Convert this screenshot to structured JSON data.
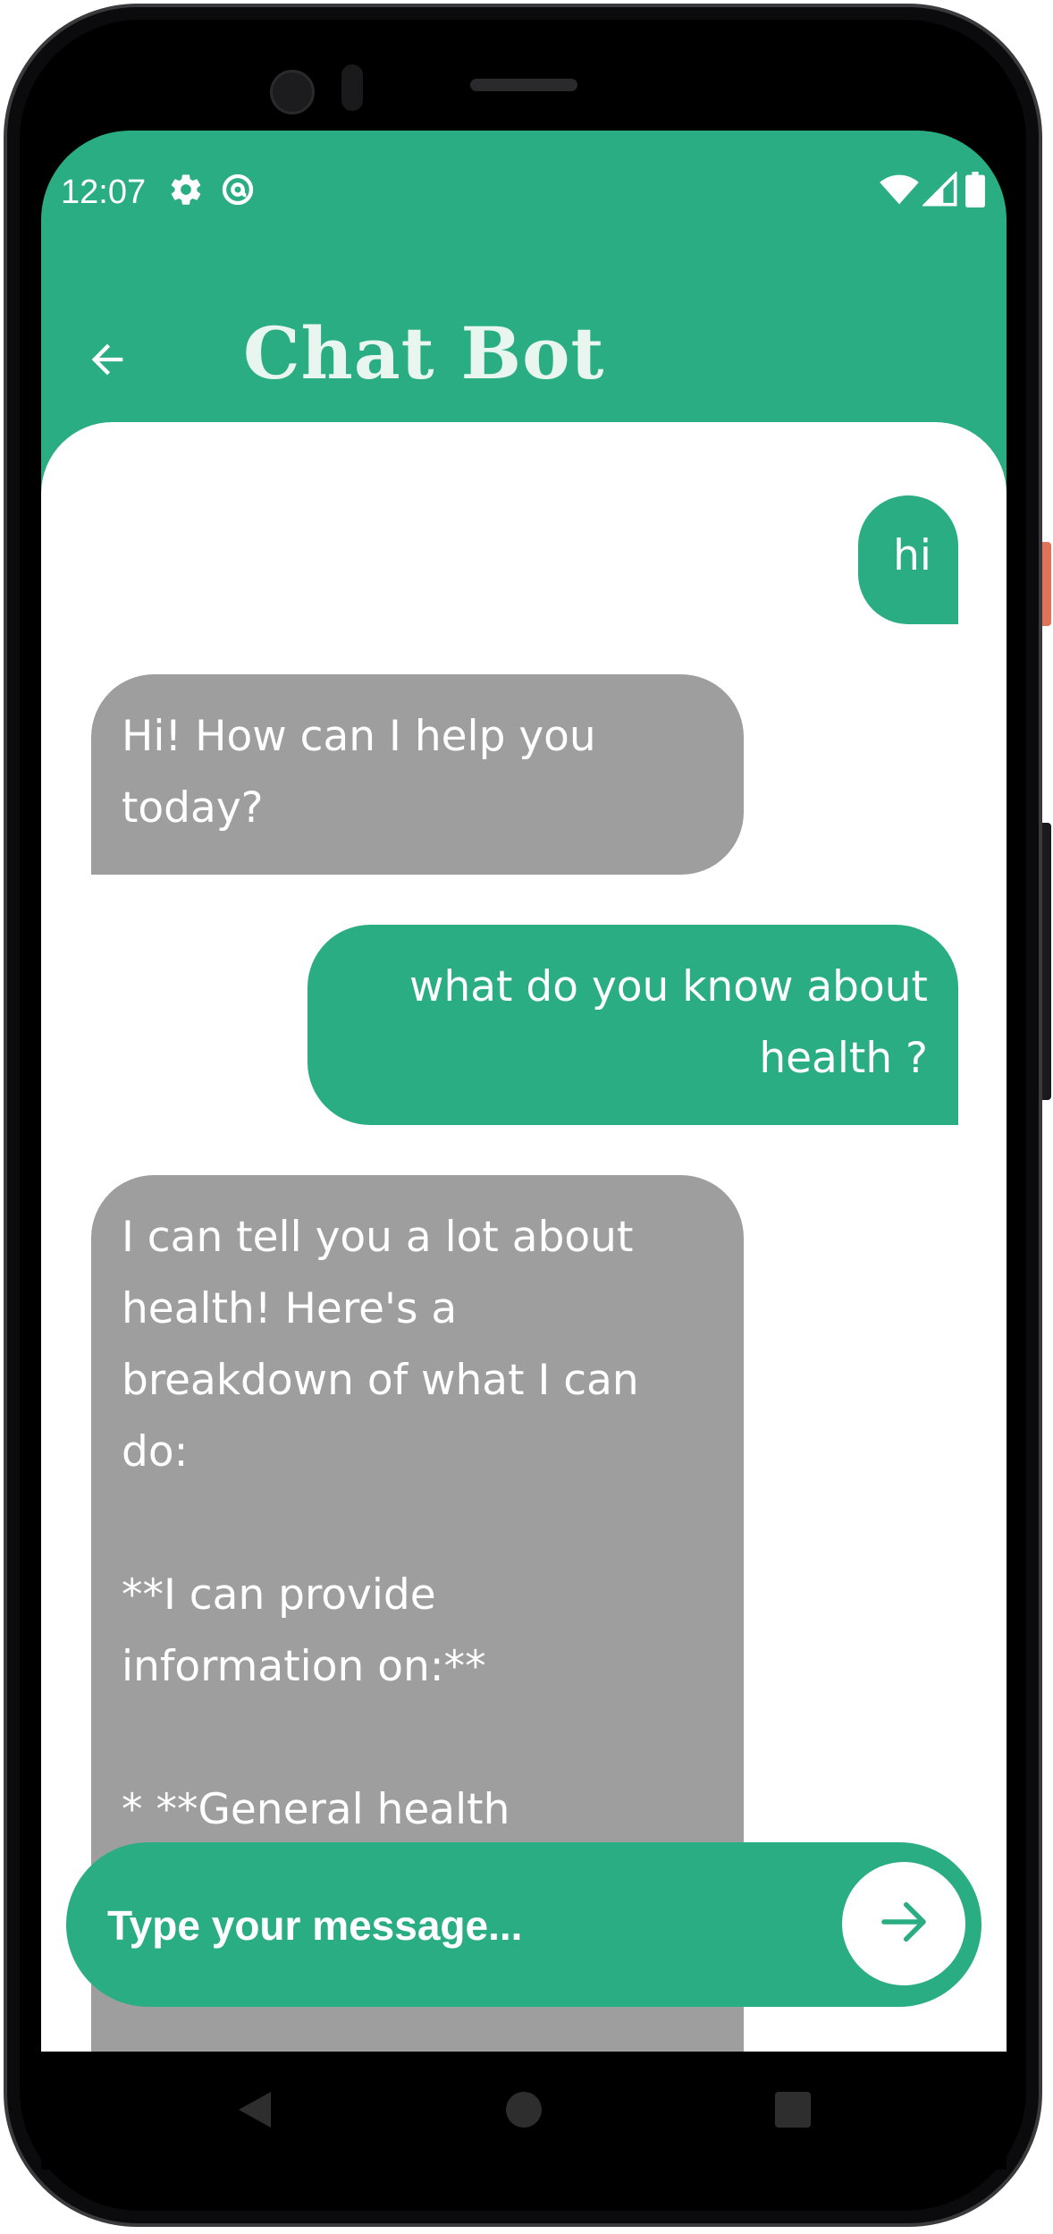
{
  "status_bar": {
    "time": "12:07",
    "icons_left": [
      "gear-icon",
      "at-sign-icon"
    ],
    "icons_right": [
      "wifi-icon",
      "signal-icon",
      "battery-icon"
    ]
  },
  "app_bar": {
    "title": "Chat Bot",
    "back_icon": "arrow-left-icon"
  },
  "messages": [
    {
      "role": "user",
      "text": "hi"
    },
    {
      "role": "bot",
      "text": "Hi! How can I help you\ntoday?"
    },
    {
      "role": "user",
      "text": "what do you know about\nhealth ?"
    },
    {
      "role": "bot",
      "text": "I can tell you a lot about\nhealth! Here's a\nbreakdown of what I can\ndo:\n\n**I can provide\ninformation on:**\n\n* **General health"
    }
  ],
  "composer": {
    "placeholder": "Type your message...",
    "value": "",
    "send_icon": "arrow-right-icon"
  },
  "nav_bar": {
    "buttons": [
      "back-triangle-icon",
      "home-circle-icon",
      "recents-square-icon"
    ]
  },
  "colors": {
    "accent": "#2aad82",
    "bot_bubble": "#9e9e9e",
    "title_text": "#e8f6ef",
    "background": "#ffffff"
  }
}
